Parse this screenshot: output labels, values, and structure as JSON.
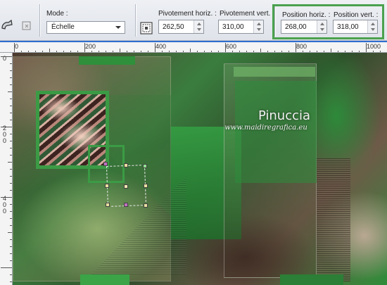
{
  "toolbar": {
    "mode_label": "Mode :",
    "mode_value": "Échelle",
    "pivot_h_label": "Pivotement horiz. :",
    "pivot_h_value": "262,50",
    "pivot_v_label": "Pivotement vert. :",
    "pivot_v_value": "310,00",
    "pos_h_label": "Position horiz. :",
    "pos_h_value": "268,00",
    "pos_v_label": "Position vert. :",
    "pos_v_value": "318,00",
    "highlight_color": "#4aa14e"
  },
  "ruler": {
    "top_labels": [
      "0",
      "200",
      "400",
      "600",
      "800",
      "1000"
    ],
    "left_labels": [
      "0",
      "2 0 0",
      "4 0 0"
    ]
  },
  "watermark": {
    "name": "Pinuccia",
    "url": "www.maidiregrafica.eu"
  },
  "icons": [
    "object-select-icon",
    "deform-icon",
    "grid-icon"
  ]
}
